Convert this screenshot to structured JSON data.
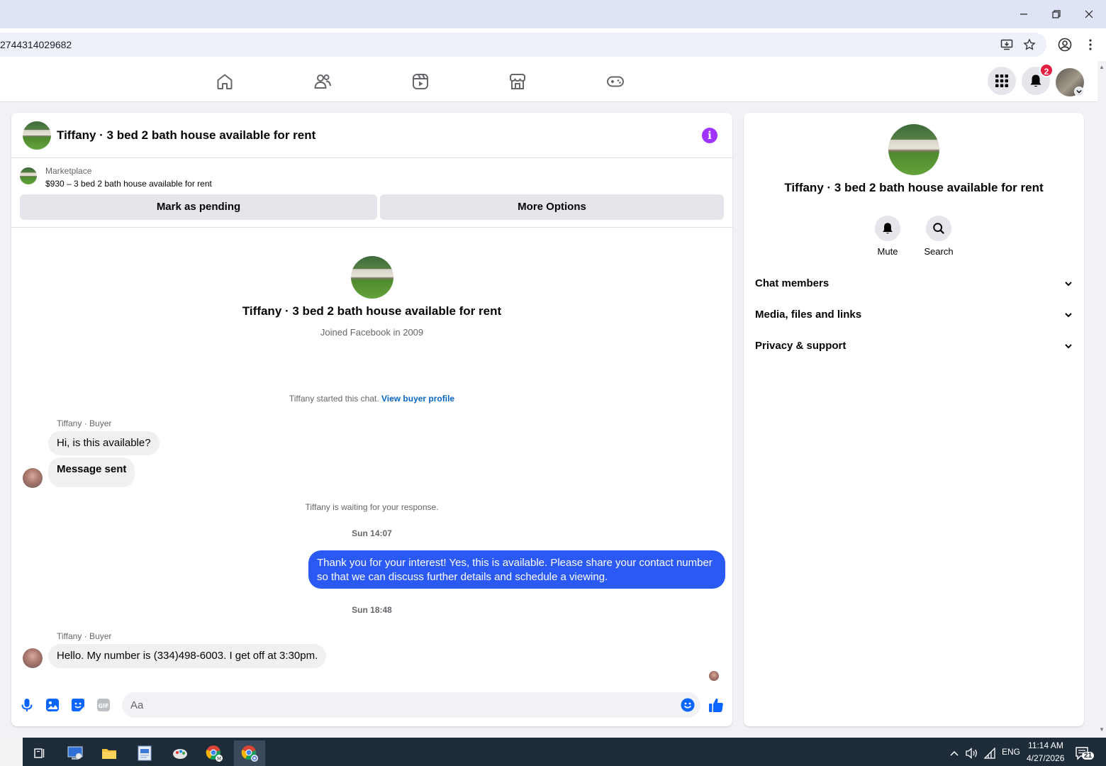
{
  "browser": {
    "url_fragment": "2744314029682"
  },
  "nav": {
    "notification_count": "2"
  },
  "chat": {
    "header_title": "Tiffany · 3 bed 2 bath house available for rent",
    "marketplace_label": "Marketplace",
    "listing_line": "$930 – 3 bed 2 bath house available for rent",
    "mark_pending_label": "Mark as pending",
    "more_options_label": "More Options",
    "profile_name": "Tiffany · 3 bed 2 bath house available for rent",
    "joined_text": "Joined Facebook in 2009",
    "started_text": "Tiffany started this chat.",
    "view_profile_link": "View buyer profile",
    "messages": [
      {
        "sender": "Tiffany · Buyer",
        "text": "Hi, is this available?"
      },
      {
        "text": "Message sent"
      },
      {
        "text": "Thank you for your interest! Yes, this is available. Please share your contact number so that we can discuss further details and schedule a viewing."
      },
      {
        "sender": "Tiffany · Buyer",
        "text": "Hello. My number is (334)498-6003. I get off at 3:30pm."
      }
    ],
    "waiting_text": "Tiffany is waiting for your response.",
    "time_1": "Sun 14:07",
    "time_2": "Sun 18:48",
    "composer_placeholder": "Aa"
  },
  "side": {
    "name": "Tiffany · 3 bed 2 bath house available for rent",
    "mute_label": "Mute",
    "search_label": "Search",
    "rows": [
      "Chat members",
      "Media, files and links",
      "Privacy & support"
    ]
  },
  "taskbar": {
    "language": "ENG",
    "time": "11:14 AM",
    "date": "4/27/2026",
    "notif_count": "21"
  },
  "colors": {
    "accent_blue": "#2b59f3",
    "info_purple": "#a033ff",
    "messenger_blue": "#0866ff"
  }
}
